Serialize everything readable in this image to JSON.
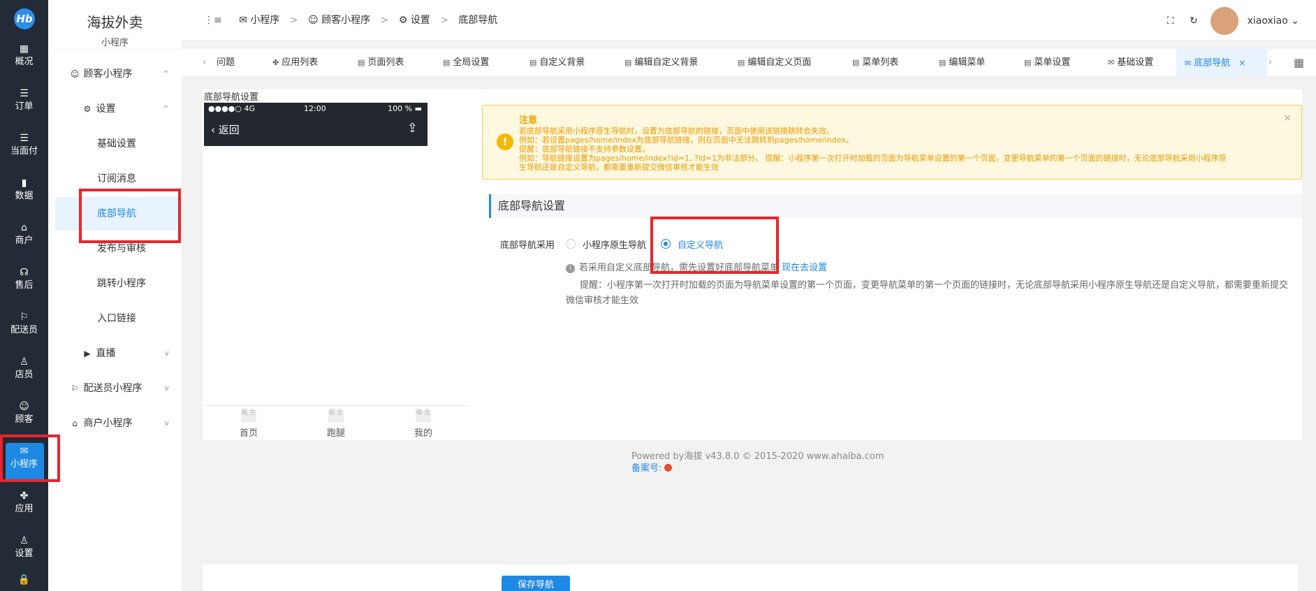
{
  "rail": {
    "logo": "Hb",
    "items": [
      {
        "icon": "▦",
        "label": "概况"
      },
      {
        "icon": "☰",
        "label": "订单"
      },
      {
        "icon": "☰",
        "label": "当面付"
      },
      {
        "icon": "▮",
        "label": "数据"
      },
      {
        "icon": "⌂",
        "label": "商户"
      },
      {
        "icon": "☊",
        "label": "售后"
      },
      {
        "icon": "⚐",
        "label": "配送员"
      },
      {
        "icon": "♙",
        "label": "店员"
      },
      {
        "icon": "☺",
        "label": "顾客"
      },
      {
        "icon": "✉",
        "label": "小程序"
      },
      {
        "icon": "✤",
        "label": "应用"
      },
      {
        "icon": "♙",
        "label": "设置"
      },
      {
        "icon": "🔒",
        "label": ""
      }
    ]
  },
  "submenu": {
    "title": "海拔外卖",
    "subtitle": "小程序",
    "items": [
      {
        "label": "顾客小程序",
        "icon": "☺",
        "chev": "^"
      },
      {
        "label": "设置",
        "icon": "⚙",
        "chev": "^"
      },
      {
        "label": "基础设置"
      },
      {
        "label": "订阅消息"
      },
      {
        "label": "底部导航"
      },
      {
        "label": "发布与审核"
      },
      {
        "label": "跳转小程序"
      },
      {
        "label": "入口链接"
      },
      {
        "label": "直播",
        "icon": "▶",
        "chev": "v"
      },
      {
        "label": "配送员小程序",
        "icon": "⚐",
        "chev": "v"
      },
      {
        "label": "商户小程序",
        "icon": "⌂",
        "chev": "v"
      }
    ]
  },
  "header": {
    "collapse_icon": "⋮≡",
    "breadcrumb": [
      "小程序",
      "顾客小程序",
      "设置",
      "底部导航"
    ],
    "separator": ">",
    "fullscreen_icon": "⛶",
    "refresh_icon": "↻",
    "username": "xiaoxiao",
    "user_chev": "⌄"
  },
  "tabs": {
    "prev": "‹",
    "next": "›",
    "grid": "▦",
    "items": [
      {
        "label": "问题",
        "icon": ""
      },
      {
        "label": "应用列表",
        "icon": "✤"
      },
      {
        "label": "页面列表",
        "icon": "▤"
      },
      {
        "label": "全局设置",
        "icon": "▤"
      },
      {
        "label": "自定义背景",
        "icon": "▤"
      },
      {
        "label": "编辑自定义背景",
        "icon": "▤"
      },
      {
        "label": "编辑自定义页面",
        "icon": "▤"
      },
      {
        "label": "菜单列表",
        "icon": "▤"
      },
      {
        "label": "编辑菜单",
        "icon": "▤"
      },
      {
        "label": "菜单设置",
        "icon": "▤"
      },
      {
        "label": "基础设置",
        "icon": "✉"
      },
      {
        "label": "底部导航",
        "icon": "✉",
        "close": "×"
      }
    ]
  },
  "panel": {
    "label": "底部导航设置",
    "phone": {
      "signal": "●●●●○ 4G",
      "time": "12:00",
      "battery": "100 % ▬",
      "back": "‹ 返回",
      "share": "⇪",
      "tabs": [
        {
          "ph": "载 生",
          "label": "首页"
        },
        {
          "ph": "载 生",
          "label": "跑腿"
        },
        {
          "ph": "载 生",
          "label": "我的"
        }
      ]
    },
    "notice": {
      "icon": "!",
      "title": "注意",
      "lines": [
        "若底部导航采用小程序原生导航时，设置为底部导航的链接，页面中使用该链接跳转会失效。",
        "例如：若设置pages/home/index为底部导航链接，则在页面中无法跳转到pages/home/index。",
        "提醒：底部导航链接不支持参数设置。",
        "例如：导航链接设置为pages/home/index?id=1, ?id=1为非法部分。 提醒：小程序第一次打开时加载的页面为导航菜单设置的第一个页面，变更导航菜单的第一个页面的链接时，无论底部导航采用小程序原",
        "生导航还是自定义导航，都需要重新提交微信审核才能生效"
      ],
      "close": "×"
    },
    "section_title": "底部导航设置",
    "form": {
      "label": "底部导航采用",
      "option_native": "小程序原生导航",
      "option_custom": "自定义导航",
      "selected": "自定义导航",
      "hint_icon": "i",
      "hint": "若采用自定义底部导航，需先设置好底部导航菜单",
      "hint_link": "现在去设置",
      "remind": "提醒：小程序第一次打开时加载的页面为导航菜单设置的第一个页面，变更导航菜单的第一个页面的链接时，无论底部导航采用小程序原生导航还是自定义导航，都需要重新提交微信审核才能生效"
    }
  },
  "footer": {
    "powered": "Powered by海拔 v43.8.0 © 2015-2020 www.ahaiba.com",
    "beian": "备案号:"
  },
  "bottom": {
    "save_label": "保存导航"
  },
  "colors": {
    "rail_bg": "#222b36",
    "accent": "#1e88e5",
    "warning_text": "#e89a00",
    "highlight_box": "#e6262e"
  }
}
